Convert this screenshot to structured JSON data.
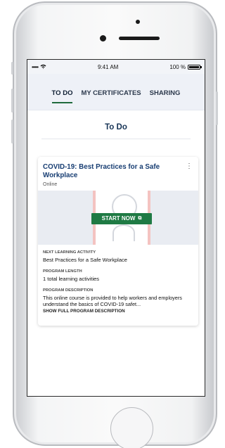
{
  "status_bar": {
    "signal": "•••••",
    "time": "9:41 AM",
    "battery": "100 %"
  },
  "tabs": [
    {
      "label": "TO DO",
      "active": true
    },
    {
      "label": "MY CERTIFICATES",
      "active": false
    },
    {
      "label": "SHARING",
      "active": false
    }
  ],
  "section_title": "To Do",
  "card": {
    "title": "COVID-19: Best Practices for a Safe Workplace",
    "subtitle": "Online",
    "start_button": "START NOW",
    "next_activity_label": "NEXT LEARNING ACTIVITY",
    "next_activity_value": "Best Practices for a Safe Workplace",
    "program_length_label": "PROGRAM LENGTH",
    "program_length_value": "1 total learning activities",
    "program_description_label": "PROGRAM DESCRIPTION",
    "program_description_value": "This online course is provided to help workers and employers understand the basics of COVID-19 safet...",
    "show_full_description": "SHOW FULL PROGRAM DESCRIPTION"
  },
  "colors": {
    "accent_green": "#1f7a44",
    "title_blue": "#173d72",
    "tab_bar_bg": "#eef1f7"
  }
}
